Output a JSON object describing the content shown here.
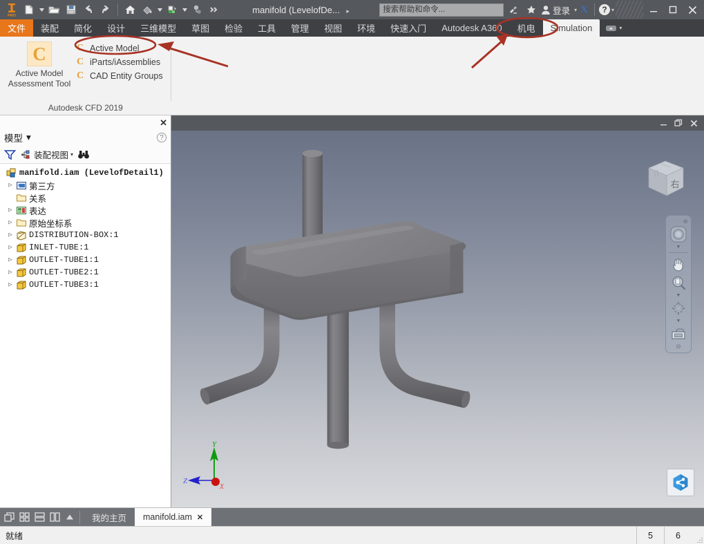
{
  "titlebar": {
    "app_icon": "inventor-pro-icon",
    "document_title": "manifold (LevelofDe...",
    "title_overflow_chevron": "▸",
    "quick_access": [
      {
        "name": "new-file-button",
        "icon": "new-file-icon",
        "has_dropdown": true
      },
      {
        "name": "open-file-button",
        "icon": "open-folder-icon",
        "has_dropdown": false
      },
      {
        "name": "save-button",
        "icon": "floppy-disk-icon",
        "has_dropdown": false
      },
      {
        "name": "undo-button",
        "icon": "undo-arrow-icon",
        "has_dropdown": false
      },
      {
        "name": "redo-button",
        "icon": "redo-arrow-icon",
        "has_dropdown": false
      },
      {
        "name": "home-button",
        "icon": "home-icon",
        "has_dropdown": false
      },
      {
        "name": "appearance-button",
        "icon": "paint-bucket-icon",
        "has_dropdown": true
      },
      {
        "name": "material-button",
        "icon": "material-swatch-icon",
        "has_dropdown": true
      },
      {
        "name": "select-button",
        "icon": "select-priority-icon",
        "has_dropdown": false
      },
      {
        "name": "more-button",
        "icon": "double-chevron-icon",
        "has_dropdown": false
      }
    ],
    "search_placeholder": "搜索帮助和命令...",
    "signin_label": "登录",
    "exchange_label": "X",
    "window_controls": {
      "minimize": "—",
      "maximize": "❐",
      "close": "✕"
    }
  },
  "ribbon": {
    "tabs": [
      {
        "label": "文件",
        "state": "file"
      },
      {
        "label": "装配",
        "state": "normal"
      },
      {
        "label": "简化",
        "state": "normal"
      },
      {
        "label": "设计",
        "state": "normal"
      },
      {
        "label": "三维模型",
        "state": "normal"
      },
      {
        "label": "草图",
        "state": "normal"
      },
      {
        "label": "检验",
        "state": "normal"
      },
      {
        "label": "工具",
        "state": "normal"
      },
      {
        "label": "管理",
        "state": "normal"
      },
      {
        "label": "视图",
        "state": "normal"
      },
      {
        "label": "环境",
        "state": "normal"
      },
      {
        "label": "快速入门",
        "state": "normal"
      },
      {
        "label": "Autodesk A360",
        "state": "normal"
      },
      {
        "label": "机电",
        "state": "normal"
      },
      {
        "label": "Simulation",
        "state": "active"
      }
    ],
    "panel": {
      "group_title": "Autodesk CFD 2019",
      "big_button": {
        "label_line1": "Active Model",
        "label_line2": "Assessment Tool",
        "icon": "cfd-c-icon"
      },
      "small_buttons": [
        {
          "label": "Active Model",
          "icon": "cfd-c-icon",
          "highlighted": true
        },
        {
          "label": "iParts/iAssemblies",
          "icon": "cfd-c-icon",
          "highlighted": false
        },
        {
          "label": "CAD Entity Groups",
          "icon": "cfd-c-icon",
          "highlighted": false
        }
      ]
    }
  },
  "annotations": {
    "ellipse_color": "#a83225",
    "arrow_color": "#a83225"
  },
  "browser": {
    "title": "模型",
    "title_chevron": "▾",
    "close_glyph": "✕",
    "help_glyph": "?",
    "toolbar": {
      "filter_icon": "funnel-filter-icon",
      "view_icon": "assembly-view-icon",
      "view_label": "装配视图",
      "view_chevron": "▾",
      "find_icon": "binoculars-find-icon"
    },
    "tree": [
      {
        "label": "manifold.iam (LevelofDetail1)",
        "icon": "assembly-icon",
        "expand": "",
        "indent": 0,
        "root": true,
        "cjk": false
      },
      {
        "label": "第三方",
        "icon": "thirdparty-icon",
        "expand": "▷",
        "indent": 1,
        "root": false,
        "cjk": true
      },
      {
        "label": "关系",
        "icon": "folder-icon",
        "expand": "",
        "indent": 1,
        "root": false,
        "cjk": true
      },
      {
        "label": "表达",
        "icon": "representation-icon",
        "expand": "▷",
        "indent": 1,
        "root": false,
        "cjk": true
      },
      {
        "label": "原始坐标系",
        "icon": "folder-icon",
        "expand": "▷",
        "indent": 1,
        "root": false,
        "cjk": true
      },
      {
        "label": "DISTRIBUTION-BOX:1",
        "icon": "part-shaded-icon",
        "expand": "▷",
        "indent": 1,
        "root": false,
        "cjk": false
      },
      {
        "label": "INLET-TUBE:1",
        "icon": "part-icon",
        "expand": "▷",
        "indent": 1,
        "root": false,
        "cjk": false
      },
      {
        "label": "OUTLET-TUBE1:1",
        "icon": "part-icon",
        "expand": "▷",
        "indent": 1,
        "root": false,
        "cjk": false
      },
      {
        "label": "OUTLET-TUBE2:1",
        "icon": "part-icon",
        "expand": "▷",
        "indent": 1,
        "root": false,
        "cjk": false
      },
      {
        "label": "OUTLET-TUBE3:1",
        "icon": "part-icon",
        "expand": "▷",
        "indent": 1,
        "root": false,
        "cjk": false
      }
    ]
  },
  "viewport": {
    "window_controls": {
      "minimize": "—",
      "restore": "❐",
      "close": "✕"
    },
    "viewcube_face": "右",
    "background_top_color": "#6a7386",
    "background_bottom_color": "#d8dade",
    "model_color": "#7d7d80",
    "axis": {
      "x_label": "X",
      "y_label": "Y",
      "z_label": "Z",
      "x_color": "#cc2222",
      "y_color": "#119911",
      "z_color": "#3333cc"
    },
    "navbar": [
      {
        "name": "full-navigation-wheel",
        "icon": "steering-wheel-icon"
      },
      {
        "name": "pan-tool",
        "icon": "hand-pan-icon"
      },
      {
        "name": "zoom-tool",
        "icon": "magnifier-zoom-icon"
      },
      {
        "name": "orbit-tool",
        "icon": "orbit-icon"
      },
      {
        "name": "look-at-tool",
        "icon": "camera-lookat-icon"
      }
    ],
    "a360_button": "share-a360-icon"
  },
  "doctabs": {
    "view_buttons": [
      {
        "name": "cascade-windows-button",
        "icon": "cascade-icon"
      },
      {
        "name": "tile-windows-button",
        "icon": "tile-grid-icon"
      },
      {
        "name": "tile-horizontal-button",
        "icon": "tile-horizontal-icon"
      },
      {
        "name": "tile-vertical-button",
        "icon": "tile-vertical-icon"
      },
      {
        "name": "tabs-scroll-up-button",
        "icon": "triangle-up-icon"
      }
    ],
    "tabs": [
      {
        "label": "我的主页",
        "active": false,
        "closable": false
      },
      {
        "label": "manifold.iam",
        "active": true,
        "closable": true,
        "close_glyph": "✕"
      }
    ]
  },
  "statusbar": {
    "message": "就绪",
    "cell1": "5",
    "cell2": "6"
  }
}
